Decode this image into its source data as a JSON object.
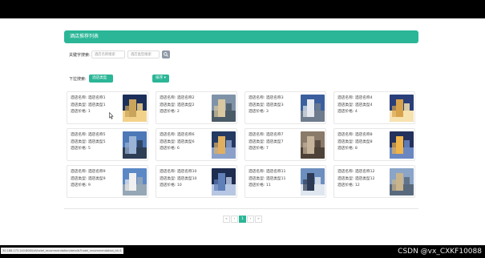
{
  "panel": {
    "title": "酒店推荐列表"
  },
  "search": {
    "label": "关键字搜索:",
    "keyword_placeholder": "酒店名称搜索",
    "type_placeholder": "酒店类型搜索"
  },
  "filters": {
    "label": "下拉搜索:",
    "type_dropdown": "酒店类型 ▾",
    "sort_dropdown": "排序 ▾"
  },
  "hotels": [
    {
      "name": "酒店名称: 酒店名称1",
      "type": "酒店类型: 酒店类型1",
      "price": "酒店价格: 1"
    },
    {
      "name": "酒店名称: 酒店名称2",
      "type": "酒店类型: 酒店类型2",
      "price": "酒店价格: 2"
    },
    {
      "name": "酒店名称: 酒店名称3",
      "type": "酒店类型: 酒店类型3",
      "price": "酒店价格: 3"
    },
    {
      "name": "酒店名称: 酒店名称4",
      "type": "酒店类型: 酒店类型4",
      "price": "酒店价格: 4"
    },
    {
      "name": "酒店名称: 酒店名称5",
      "type": "酒店类型: 酒店类型5",
      "price": "酒店价格: 5"
    },
    {
      "name": "酒店名称: 酒店名称6",
      "type": "酒店类型: 酒店类型6",
      "price": "酒店价格: 6"
    },
    {
      "name": "酒店名称: 酒店名称7",
      "type": "酒店类型: 酒店类型7",
      "price": "酒店价格: 7"
    },
    {
      "name": "酒店名称: 酒店名称8",
      "type": "酒店类型: 酒店类型8",
      "price": "酒店价格: 8"
    },
    {
      "name": "酒店名称: 酒店名称9",
      "type": "酒店类型: 酒店类型9",
      "price": "酒店价格: 9"
    },
    {
      "name": "酒店名称: 酒店名称10",
      "type": "酒店类型: 酒店类型10",
      "price": "酒店价格: 10"
    },
    {
      "name": "酒店名称: 酒店名称11",
      "type": "酒店类型: 酒店类型11",
      "price": "酒店价格: 11"
    },
    {
      "name": "酒店名称: 酒店名称12",
      "type": "酒店类型: 酒店类型12",
      "price": "酒店价格: 12"
    }
  ],
  "pagination": {
    "first": "«",
    "prev": "‹",
    "current": "1",
    "next": "›",
    "last": "»"
  },
  "status": {
    "url": "30.188.173.140:8080/#/hotel_recommendation/details?hotel_recommendation_id=1",
    "watermark": "CSDN @vx_CXKF10088"
  },
  "colors": {
    "accent": "#2bb697",
    "search_button": "#8e9aa6"
  },
  "icons": {
    "search_button": "search-icon",
    "cursor": "cursor-icon"
  }
}
